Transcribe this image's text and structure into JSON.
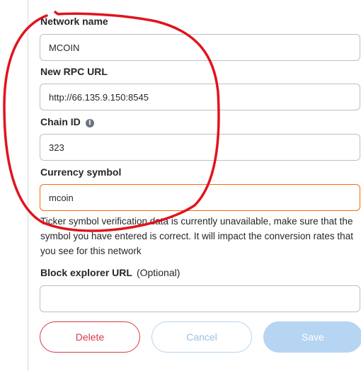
{
  "form": {
    "network_name": {
      "label": "Network name",
      "value": "MCOIN"
    },
    "rpc_url": {
      "label": "New RPC URL",
      "value": "http://66.135.9.150:8545"
    },
    "chain_id": {
      "label": "Chain ID",
      "value": "323"
    },
    "currency_symbol": {
      "label": "Currency symbol",
      "value": "mcoin",
      "helper": "Ticker symbol verification data is currently unavailable, make sure that the symbol you have entered is correct. It will impact the conversion rates that you see for this network"
    },
    "block_explorer": {
      "label": "Block explorer URL",
      "optional": "(Optional)",
      "value": ""
    }
  },
  "buttons": {
    "delete": "Delete",
    "cancel": "Cancel",
    "save": "Save"
  },
  "icons": {
    "chain_id_info": "info-icon",
    "info_glyph": "i"
  },
  "colors": {
    "warning_border": "#f66a0a",
    "delete": "#d73a49",
    "primary_disabled": "#b6d5f3",
    "annotation": "#e0141e"
  }
}
